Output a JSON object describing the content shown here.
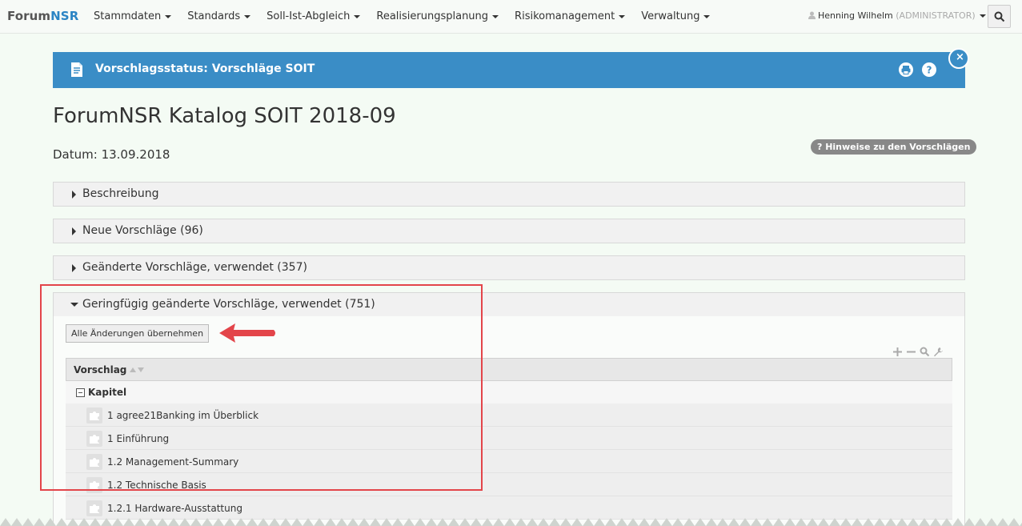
{
  "navbar": {
    "brand_part1": "Forum",
    "brand_part2": "NSR",
    "menu": [
      {
        "label": "Stammdaten",
        "dropdown": true
      },
      {
        "label": "Standards",
        "dropdown": true
      },
      {
        "label": "Soll-Ist-Abgleich",
        "dropdown": true
      },
      {
        "label": "Realisierungsplanung",
        "dropdown": true
      },
      {
        "label": "Risikomanagement",
        "dropdown": true
      },
      {
        "label": "Verwaltung",
        "dropdown": true
      }
    ],
    "user_name": "Henning Wilhelm",
    "user_role": "(ADMINISTRATOR)",
    "search_icon": "search-icon",
    "user_icon": "user-icon"
  },
  "header": {
    "title": "Vorschlagsstatus: Vorschläge SOIT",
    "icon": "document-icon",
    "actions": [
      "print-icon",
      "help-icon"
    ],
    "close_label": "×"
  },
  "page": {
    "title": "ForumNSR Katalog SOIT 2018-09",
    "datum_label": "Datum: 13.09.2018",
    "hint_badge": "? Hinweise zu den Vorschlägen"
  },
  "sections": [
    {
      "label": "Beschreibung",
      "expanded": false
    },
    {
      "label": "Neue Vorschläge (96)",
      "expanded": false
    },
    {
      "label": "Geänderte Vorschläge, verwendet (357)",
      "expanded": false
    },
    {
      "label": "Geringfügig geänderte Vorschläge, verwendet (751)",
      "expanded": true
    }
  ],
  "expanded_section": {
    "apply_button": "Alle Änderungen übernehmen",
    "tree_tools": [
      "plus-icon",
      "minus-icon",
      "search-icon",
      "wrench-icon"
    ],
    "grid": {
      "column_header": "Vorschlag",
      "group_label": "Kapitel",
      "rows": [
        "1 agree21Banking im Überblick",
        "1 Einführung",
        "1.2 Management-Summary",
        "1.2 Technische Basis",
        "1.2.1 Hardware-Ausstattung"
      ]
    }
  },
  "colors": {
    "accent": "#3a8dc6",
    "highlight": "#e3454a",
    "background": "#f4fbf4"
  }
}
